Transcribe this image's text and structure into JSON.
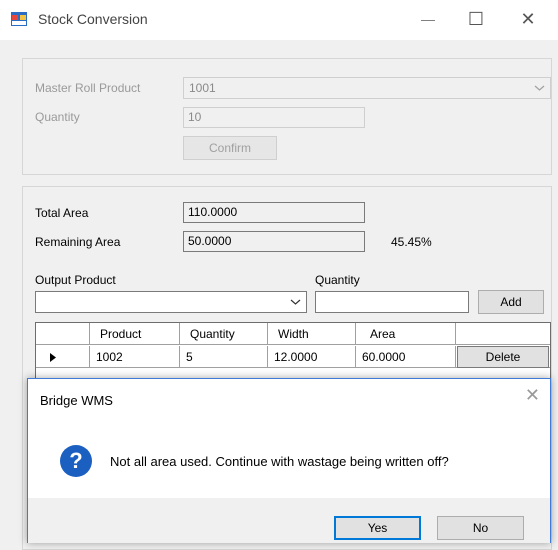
{
  "window": {
    "title": "Stock Conversion",
    "minimize_symbol": "—",
    "maximize_symbol": "☐",
    "close_symbol": "✕"
  },
  "master_group": {
    "master_roll_label": "Master Roll Product",
    "master_roll_value": "1001",
    "quantity_label": "Quantity",
    "quantity_value": "10",
    "confirm_label": "Confirm"
  },
  "area_group": {
    "total_area_label": "Total Area",
    "total_area_value": "110.0000",
    "remaining_area_label": "Remaining Area",
    "remaining_area_value": "50.0000",
    "remaining_percent": "45.45%",
    "output_product_label": "Output Product",
    "output_product_value": "",
    "quantity_label": "Quantity",
    "quantity_value": "",
    "add_label": "Add"
  },
  "grid": {
    "columns": [
      "Product",
      "Quantity",
      "Width",
      "Area"
    ],
    "rows": [
      {
        "product": "1002",
        "quantity": "5",
        "width": "12.0000",
        "area": "60.0000",
        "action": "Delete"
      }
    ]
  },
  "dialog": {
    "title": "Bridge WMS",
    "close_symbol": "✕",
    "icon_glyph": "?",
    "message": "Not all area used. Continue with wastage being written off?",
    "yes_label": "Yes",
    "no_label": "No"
  },
  "colors": {
    "accent": "#0078d7",
    "question_icon": "#1b5fc1"
  }
}
